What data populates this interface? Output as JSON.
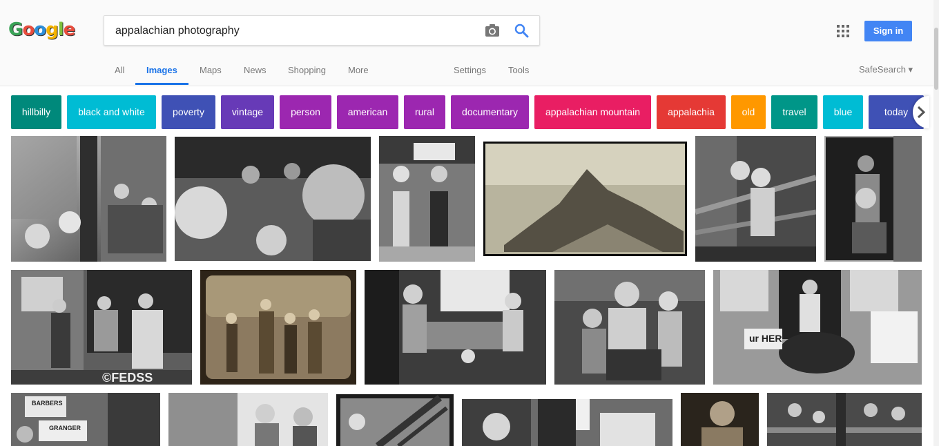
{
  "logo": {
    "letters": [
      {
        "ch": "G",
        "color": "#3aa357"
      },
      {
        "ch": "o",
        "color": "#e84c3d"
      },
      {
        "ch": "o",
        "color": "#2c8fdb"
      },
      {
        "ch": "g",
        "color": "#f5b400"
      },
      {
        "ch": "l",
        "color": "#7cbf3b"
      },
      {
        "ch": "e",
        "color": "#e84c3d"
      }
    ]
  },
  "search": {
    "query": "appalachian photography"
  },
  "header": {
    "signin_label": "Sign in",
    "safesearch_label": "SafeSearch ▾"
  },
  "tabs": [
    {
      "label": "All"
    },
    {
      "label": "Images"
    },
    {
      "label": "Maps"
    },
    {
      "label": "News"
    },
    {
      "label": "Shopping"
    },
    {
      "label": "More"
    },
    {
      "label": "Settings"
    },
    {
      "label": "Tools"
    }
  ],
  "chips": [
    {
      "label": "hillbilly",
      "color": "#00897b"
    },
    {
      "label": "black and white",
      "color": "#00bcd4"
    },
    {
      "label": "poverty",
      "color": "#3f51b5"
    },
    {
      "label": "vintage",
      "color": "#673ab7"
    },
    {
      "label": "person",
      "color": "#9c27b0"
    },
    {
      "label": "american",
      "color": "#9c27b0"
    },
    {
      "label": "rural",
      "color": "#9c27b0"
    },
    {
      "label": "documentary",
      "color": "#9c27b0"
    },
    {
      "label": "appalachian mountain",
      "color": "#e91e63"
    },
    {
      "label": "appalachia",
      "color": "#e53935"
    },
    {
      "label": "old",
      "color": "#ff9800"
    },
    {
      "label": "travel",
      "color": "#009688"
    },
    {
      "label": "blue",
      "color": "#00bcd4"
    },
    {
      "label": "today",
      "color": "#3f51b5"
    }
  ],
  "image_captions": {
    "r2c1_watermark": "©FEDSS",
    "r2c5_sign_left": "ur HER",
    "r3c1_sign_top": "BARBERS",
    "r3c1_sign_bottom": "GRANGER"
  }
}
